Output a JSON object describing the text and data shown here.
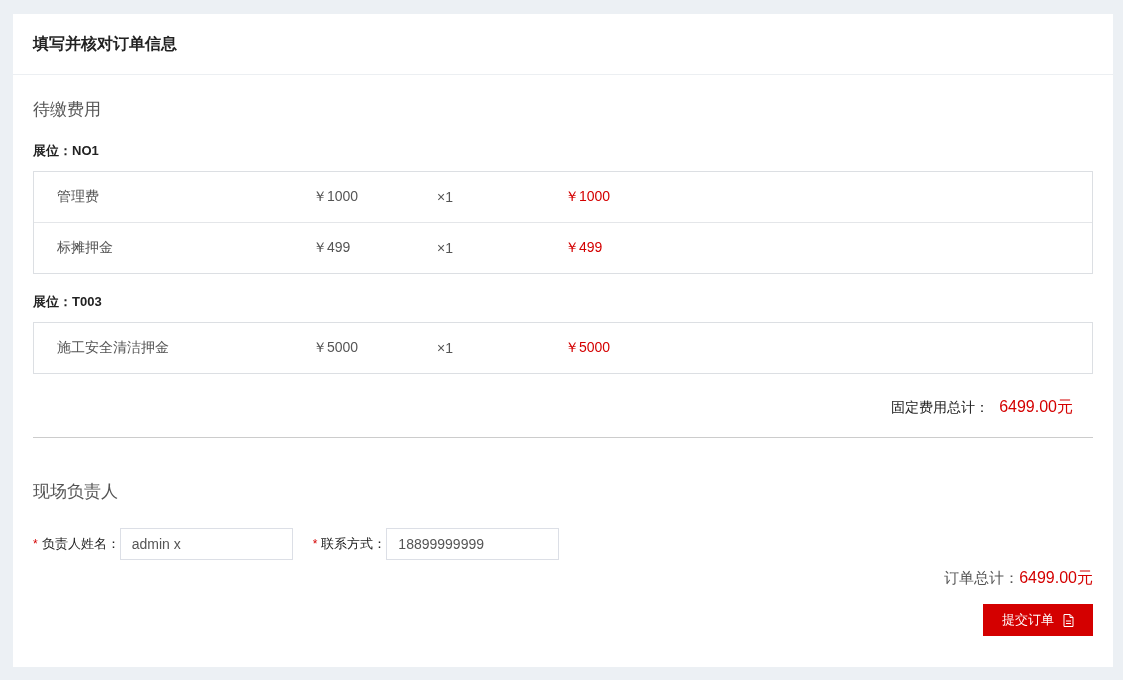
{
  "header": {
    "title": "填写并核对订单信息"
  },
  "fees_section": {
    "title": "待缴费用",
    "booths": [
      {
        "label": "展位：NO1",
        "items": [
          {
            "name": "管理费",
            "price": "￥1000",
            "quantity": "×1",
            "subtotal": "￥1000"
          },
          {
            "name": "标摊押金",
            "price": "￥499",
            "quantity": "×1",
            "subtotal": "￥499"
          }
        ]
      },
      {
        "label": "展位：T003",
        "items": [
          {
            "name": "施工安全清洁押金",
            "price": "￥5000",
            "quantity": "×1",
            "subtotal": "￥5000"
          }
        ]
      }
    ],
    "total_label": "固定费用总计：",
    "total_value": "6499.00元"
  },
  "contact_section": {
    "title": "现场负责人",
    "fields": [
      {
        "required_mark": "*",
        "label": "负责人姓名：",
        "value": "admin x"
      },
      {
        "required_mark": "*",
        "label": "联系方式：",
        "value": "18899999999"
      }
    ]
  },
  "order_total": {
    "label": "订单总计：",
    "value": "6499.00元"
  },
  "submit_button": {
    "label": "提交订单"
  }
}
